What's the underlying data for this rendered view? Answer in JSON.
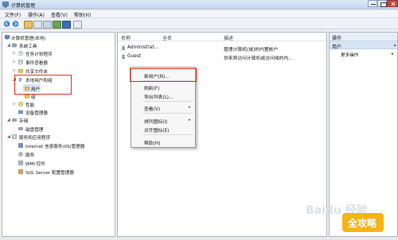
{
  "window": {
    "title": "计算机管理"
  },
  "menu": [
    "文件(F)",
    "操作(A)",
    "查看(V)",
    "帮助(H)"
  ],
  "tree": {
    "root": "计算机管理(本地)",
    "nodes": [
      "系统工具",
      "任务计划程序",
      "事件查看器",
      "共享文件夹",
      "本地用户和组",
      "用户",
      "组",
      "性能",
      "设备管理器",
      "存储",
      "磁盘管理",
      "服务和应用程序",
      "Internet 信息服务(IIS)管理器",
      "服务",
      "WMI 控件",
      "SQL Server 配置管理器"
    ]
  },
  "list": {
    "columns": {
      "name": "名称",
      "fullname": "全名",
      "description": "描述"
    },
    "rows": [
      {
        "name": "Administrat...",
        "fullname": "",
        "description": "管理计算机(域)的内置帐户"
      },
      {
        "name": "Guest",
        "fullname": "",
        "description": "供来宾访问计算机或访问域的内..."
      }
    ]
  },
  "actions": {
    "header": "操作",
    "section": "用户",
    "more": "更多操作"
  },
  "context_menu": {
    "new_user": "新用户(N)...",
    "refresh": "刷新(F)",
    "export": "导出列表(L)...",
    "view": "查看(V)",
    "arrange": "排列图标(I)",
    "align": "对齐图标(E)",
    "help": "帮助(H)"
  },
  "watermark": {
    "text": "Baidu 经验",
    "badge": "全攻略"
  },
  "colors": {
    "highlight_red": "#e0261b",
    "selection_blue": "#d6e4f5",
    "title_grad": "#c4d7ef"
  }
}
